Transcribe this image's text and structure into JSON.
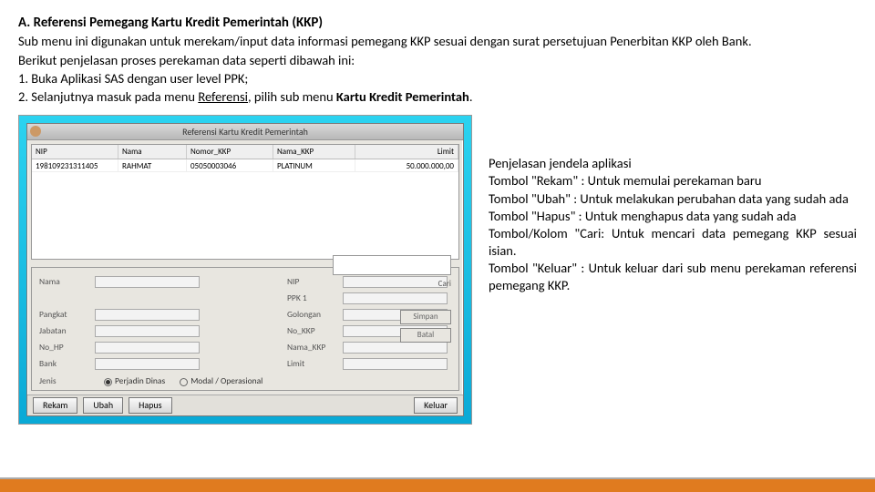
{
  "heading": "A.  Referensi Pemegang Kartu Kredit Pemerintah (KKP)",
  "intro1": "Sub menu ini digunakan untuk merekam/input data informasi pemegang KKP sesuai dengan surat persetujuan Penerbitan KKP oleh Bank.",
  "intro2": "Berikut penjelasan proses perekaman data seperti dibawah ini:",
  "step1": "1. Buka Aplikasi SAS dengan user level PPK;",
  "step2_a": "2. Selanjutnya masuk pada menu ",
  "step2_u": "Referensi",
  "step2_b": ", pilih sub menu ",
  "step2_c": "Kartu Kredit Pemerintah",
  "step2_d": ".",
  "win_title": "Referensi Kartu Kredit Pemerintah",
  "th": {
    "c1": "NIP",
    "c2": "Nama",
    "c3": "Nomor_KKP",
    "c4": "Nama_KKP",
    "c5": "Limit"
  },
  "row": {
    "c1": "198109231311405",
    "c2": "RAHMAT",
    "c3": "05050003046",
    "c4": "PLATINUM",
    "c5": "50.000.000,00"
  },
  "form_labels": {
    "nama": "Nama",
    "nip": "NIP",
    "pangkat": "Pangkat",
    "golongan": "Golongan",
    "jabatan": "Jabatan",
    "no_kkp": "No_KKP",
    "no_hp": "No_HP",
    "nama_kkp": "Nama_KKP",
    "bank": "Bank",
    "limit": "Limit",
    "ppk": "PPK 1",
    "jenis": "Jenis"
  },
  "radio": {
    "r1": "Perjadin Dinas",
    "r2": "Modal / Operasional"
  },
  "side": {
    "simpan": "Simpan",
    "batal": "Batal"
  },
  "cari": "Cari",
  "btns": {
    "rekam": "Rekam",
    "ubah": "Ubah",
    "hapus": "Hapus",
    "keluar": "Keluar"
  },
  "exp": {
    "l1": "Penjelasan jendela aplikasi",
    "l2": "Tombol \"Rekam\" : Untuk memulai perekaman baru",
    "l3": "Tombol \"Ubah\" : Untuk melakukan perubahan data yang sudah ada",
    "l4": "Tombol \"Hapus\" : Untuk menghapus data yang sudah ada",
    "l5": "Tombol/Kolom \"Cari: Untuk mencari data pemegang KKP sesuai isian.",
    "l6": "Tombol \"Keluar\" : Untuk keluar dari sub menu perekaman referensi pemegang KKP."
  }
}
